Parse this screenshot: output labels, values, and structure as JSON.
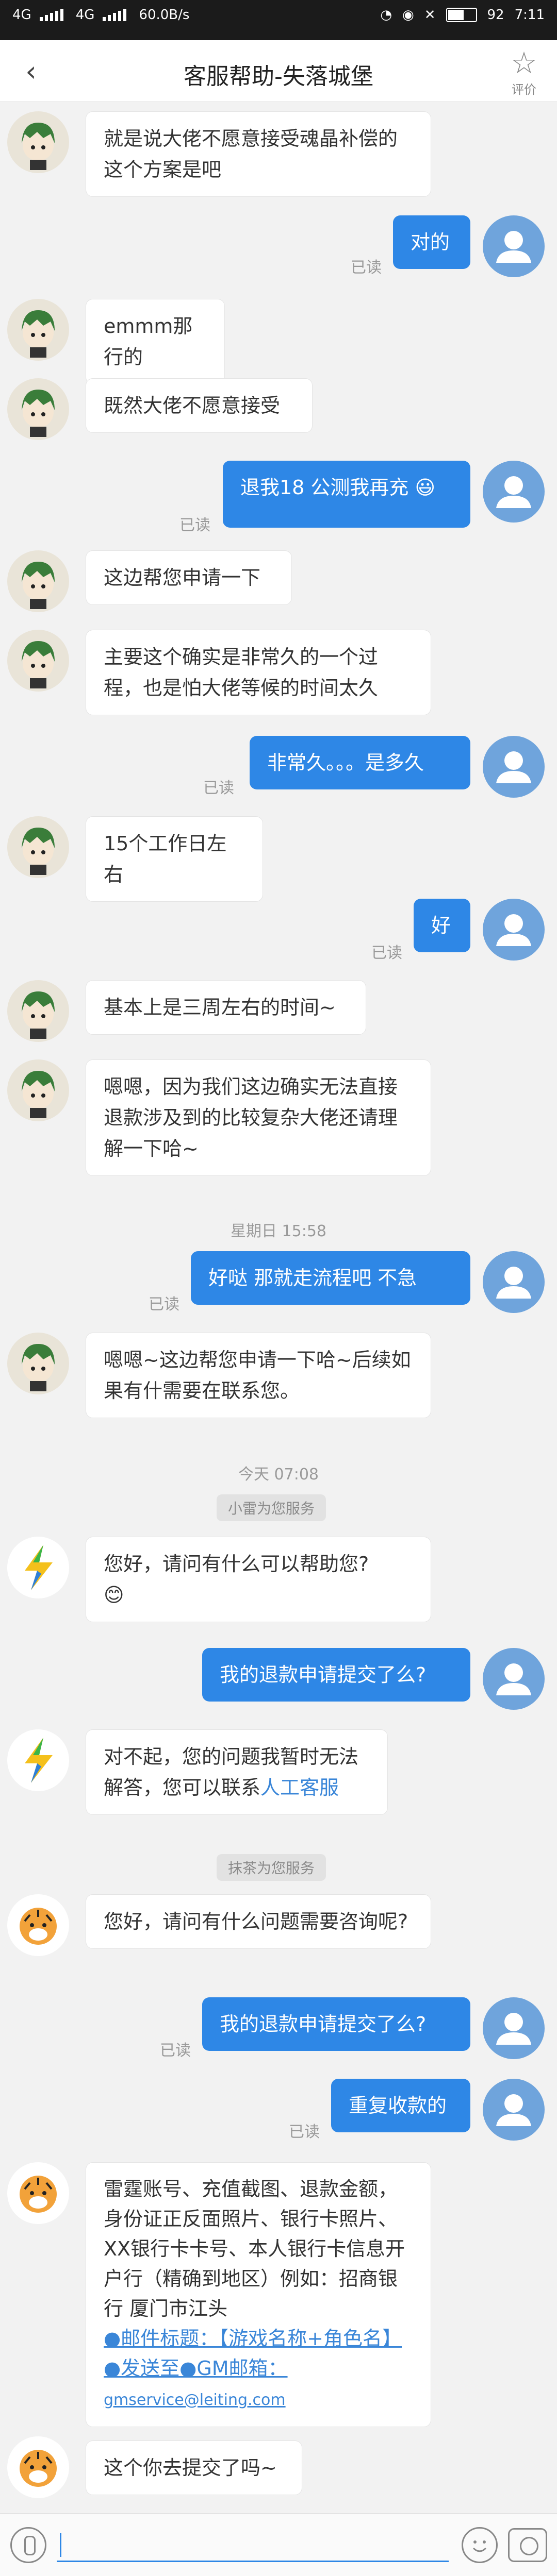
{
  "status": {
    "signal1": "4G",
    "signal2": "4G",
    "speed": "60.0B/s",
    "battery": "92",
    "time": "7:11"
  },
  "header": {
    "title": "客服帮助-失落城堡",
    "rate_label": "评价"
  },
  "read_label": "已读",
  "messages": {
    "m1": "就是说大佬不愿意接受魂晶补偿的这个方案是吧",
    "m2": "对的",
    "m3": "emmm那行的",
    "m4": "既然大佬不愿意接受",
    "m5": "退我18 公测我再充",
    "m5_emoji": "😃",
    "m6": "这边帮您申请一下",
    "m7": "主要这个确实是非常久的一个过程，也是怕大佬等候的时间太久",
    "m8": "非常久。。。是多久",
    "m9": "15个工作日左右",
    "m10": "好",
    "m11": "基本上是三周左右的时间~",
    "m12": "嗯嗯，因为我们这边确实无法直接退款涉及到的比较复杂大佬还请理解一下哈~",
    "m13": "好哒 那就走流程吧 不急",
    "m14": "嗯嗯~这边帮您申请一下哈~后续如果有什需要在联系您。",
    "m15": "您好，请问有什么可以帮助您?",
    "m15_emoji": "😊",
    "m16": "我的退款申请提交了么?",
    "m17a": "对不起，您的问题我暂时无法解答，您可以联系",
    "m17b": "人工客服",
    "m18": "您好，请问有什么问题需要咨询呢?",
    "m19": "我的退款申请提交了么?",
    "m20": "重复收款的",
    "m21_text": "雷霆账号、充值截图、退款金额，身份证正反面照片、银行卡照片、XX银行卡卡号、本人银行卡信息开户行（精确到地区）例如：招商银行 厦门市江头",
    "m21_link1": "●邮件标题：【游戏名称+角色名】●发送至●GM邮箱：",
    "m21_email": "gmservice@leiting.com",
    "m22": "这个你去提交了吗~"
  },
  "times": {
    "t1": "星期日 15:58",
    "t2": "今天 07:08"
  },
  "pills": {
    "p1": "小雷为您服务",
    "p2": "抹茶为您服务"
  }
}
